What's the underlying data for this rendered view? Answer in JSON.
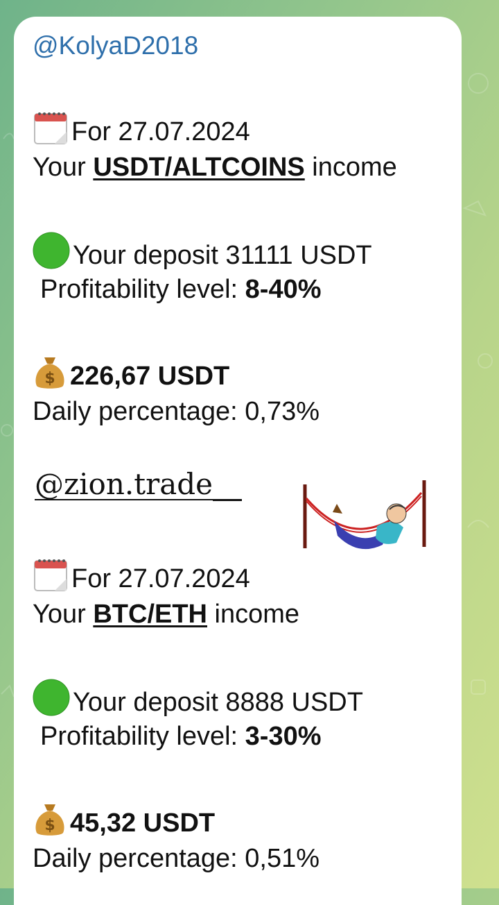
{
  "sender": "@KolyaD2018",
  "sections": [
    {
      "date_line": "For 27.07.2024",
      "income_prefix": "Your ",
      "income_pair": "USDT/ALTCOINS",
      "income_suffix": " income",
      "deposit": "Your deposit 31111 USDT",
      "profit_label": "Profitability level: ",
      "profit_value": "8-40%",
      "amount": "226,67 USDT",
      "daily": "Daily percentage: 0,73%"
    },
    {
      "date_line": "For 27.07.2024",
      "income_prefix": "Your ",
      "income_pair": "BTC/ETH",
      "income_suffix": " income",
      "deposit": "Your deposit 8888 USDT",
      "profit_label": "Profitability level: ",
      "profit_value": "3-30%",
      "amount": "45,32 USDT",
      "daily": "Daily percentage: 0,51%"
    }
  ],
  "watermark": "@zion.trade__",
  "icons": {
    "calendar": "calendar-icon",
    "green_circle": "green-circle-icon",
    "money_bag": "money-bag-icon",
    "hammock": "hammock-man-image"
  },
  "colors": {
    "sender": "#2e6fab",
    "green_circle": "#3fb52f",
    "money_bag": "#c98f2c"
  }
}
